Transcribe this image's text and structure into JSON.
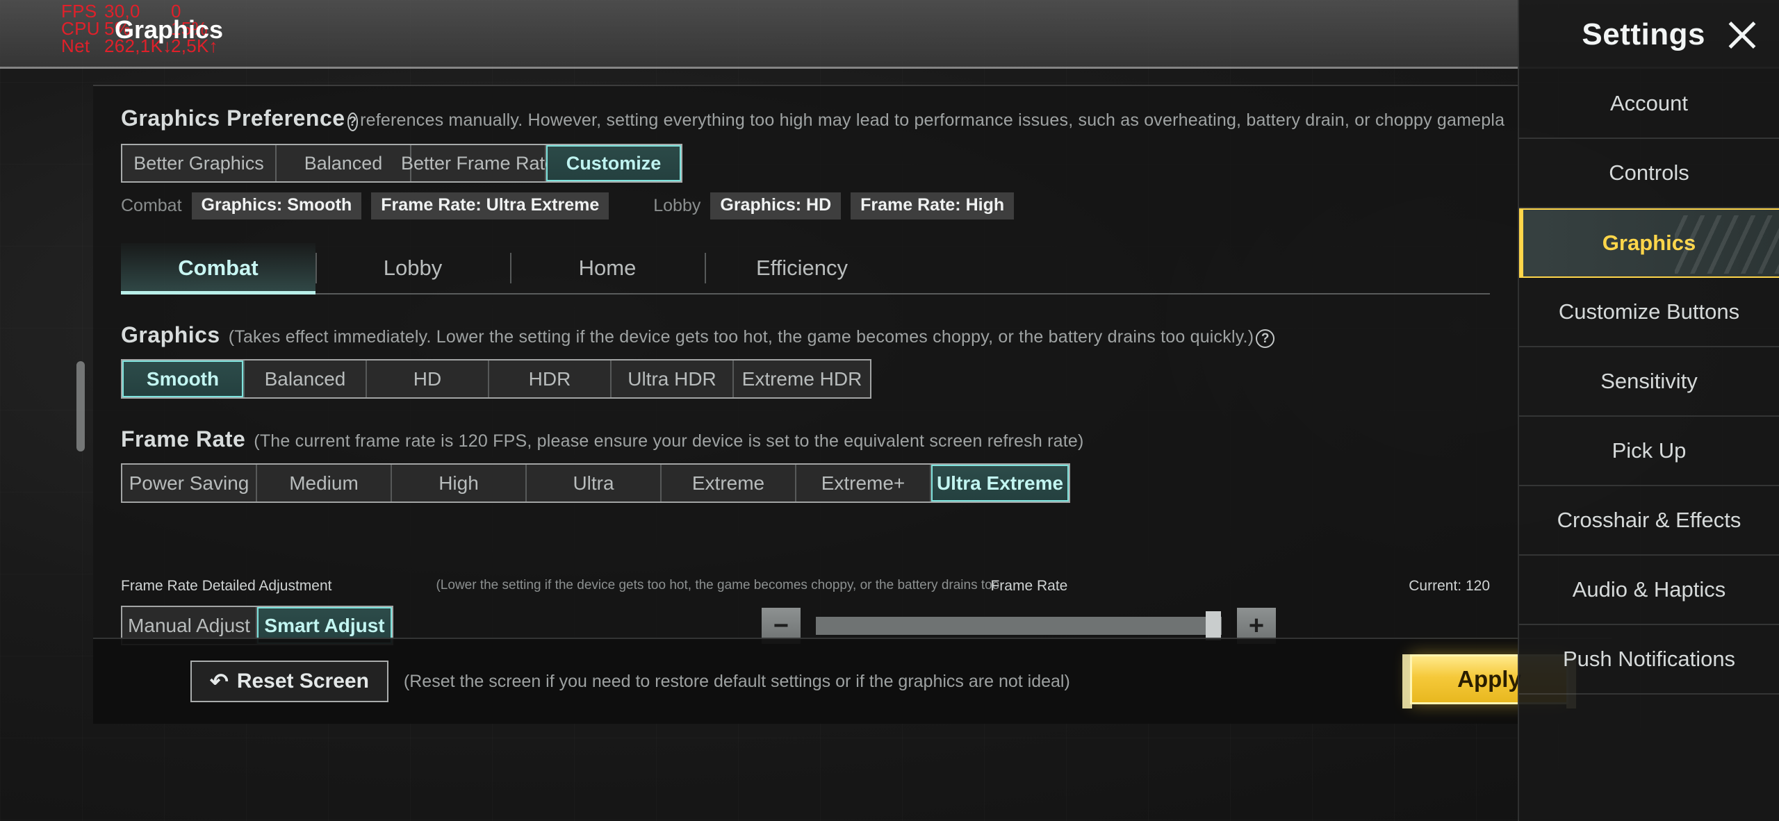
{
  "perf_overlay": {
    "rows": [
      {
        "label": "FPS",
        "v1": "30,0",
        "v2": "0"
      },
      {
        "label": "CPU",
        "v1": "5%",
        "v2": "15%"
      },
      {
        "label": "Net",
        "v1": "262,1K↓",
        "v2": "2,5K↑"
      }
    ]
  },
  "window_title": "Graphics",
  "preference": {
    "title": "Graphics Preference",
    "help_icon": "question-mark-icon",
    "description": "references manually. However, setting everything too high may lead to performance issues, such as overheating, battery drain, or choppy gamepla",
    "options": [
      "Better Graphics",
      "Balanced",
      "Better Frame Rate",
      "Customize"
    ],
    "selected": "Customize",
    "summary": [
      {
        "scope": "Combat",
        "chips": [
          "Graphics: Smooth",
          "Frame Rate: Ultra Extreme"
        ]
      },
      {
        "scope": "Lobby",
        "chips": [
          "Graphics: HD",
          "Frame Rate: High"
        ]
      }
    ]
  },
  "tabs": {
    "items": [
      "Combat",
      "Lobby",
      "Home",
      "Efficiency"
    ],
    "active": "Combat"
  },
  "graphics": {
    "title": "Graphics",
    "description": "(Takes effect immediately. Lower the setting if the device gets too hot, the game becomes choppy, or the battery drains too quickly.)",
    "help_icon": "question-mark-icon",
    "options": [
      "Smooth",
      "Balanced",
      "HD",
      "HDR",
      "Ultra HDR",
      "Extreme HDR"
    ],
    "selected": "Smooth"
  },
  "frame_rate": {
    "title": "Frame Rate",
    "description": "(The current frame rate is 120 FPS, please ensure your device is set to the equivalent screen refresh rate)",
    "options": [
      "Power Saving",
      "Medium",
      "High",
      "Ultra",
      "Extreme",
      "Extreme+",
      "Ultra Extreme"
    ],
    "selected": "Ultra Extreme"
  },
  "detailed_adjustment": {
    "title": "Frame Rate Detailed Adjustment",
    "description": "(Lower the setting if the device gets too hot, the game becomes choppy, or the battery drains too quickly)",
    "options": [
      "Manual Adjust",
      "Smart Adjust"
    ],
    "selected": "Smart Adjust",
    "slider": {
      "label": "Frame Rate",
      "current_label": "Current: 120",
      "minus_icon": "minus-icon",
      "plus_icon": "plus-icon",
      "value_percent": 98
    }
  },
  "bottom_bar": {
    "reset_icon": "reset-arrow-icon",
    "reset_label": "Reset Screen",
    "reset_description": "(Reset the screen if you need to restore default settings or if the graphics are not ideal)",
    "apply_label": "Apply"
  },
  "sidebar": {
    "title": "Settings",
    "close_icon": "close-icon",
    "items": [
      "Account",
      "Controls",
      "Graphics",
      "Customize Buttons",
      "Sensitivity",
      "Pick Up",
      "Crosshair & Effects",
      "Audio & Haptics",
      "Push Notifications"
    ],
    "active": "Graphics"
  },
  "colors": {
    "accent_cyan": "#7fe3dd",
    "accent_yellow": "#ffd64a",
    "apply_yellow": "#f5c93a",
    "perf_red": "#e0202a"
  }
}
